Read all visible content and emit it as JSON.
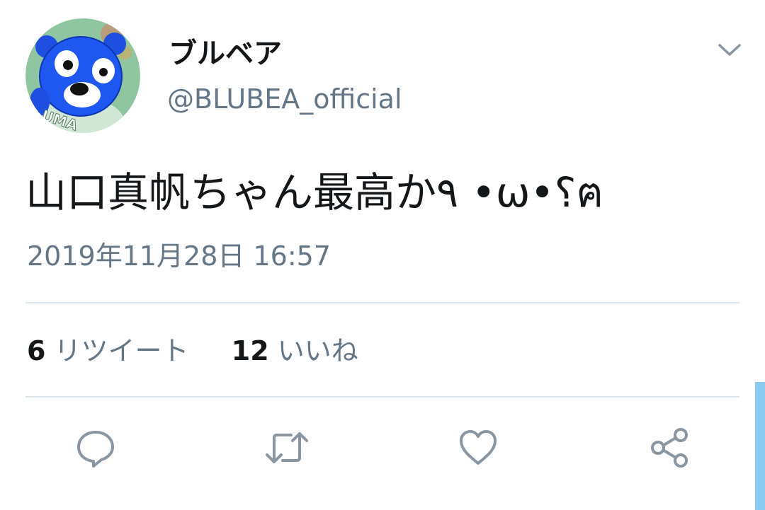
{
  "user": {
    "display_name": "ブルベア",
    "handle": "@BLUBEA_official",
    "avatar_label": "UMA"
  },
  "tweet": {
    "text": "山口真帆ちゃん最高か٩ •ω•؟ฅ",
    "timestamp": "2019年11月28日 16:57"
  },
  "stats": {
    "retweets_count": "6",
    "retweets_label": "リツイート",
    "likes_count": "12",
    "likes_label": "いいね"
  },
  "actions": {
    "icons": [
      "reply-icon",
      "retweet-icon",
      "like-icon",
      "share-icon"
    ]
  },
  "colors": {
    "text_primary": "#14171a",
    "text_secondary": "#657786",
    "divider": "#e1e8ed",
    "accent": "#1da1f2"
  }
}
